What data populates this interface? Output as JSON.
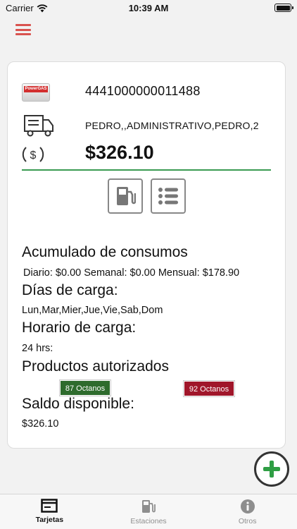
{
  "status_bar": {
    "carrier": "Carrier",
    "time": "10:39 AM"
  },
  "card": {
    "number": "4441000000011488",
    "owner": "PEDRO,,ADMINISTRATIVO,PEDRO,2",
    "balance": "$326.10",
    "logo_text": "PowerGAS",
    "accent_color": "#3a9b52"
  },
  "sections": {
    "consumption_title": "Acumulado de consumos",
    "consumption_text": "Diario: $0.00 Semanal: $0.00 Mensual: $178.90",
    "days_title": "Días de carga:",
    "days_text": "Lun,Mar,Mier,Jue,Vie,Sab,Dom",
    "hours_title": "Horario de carga:",
    "hours_text": "24 hrs:",
    "products_title": "Productos autorizados",
    "products": [
      {
        "label": "87 Octanos",
        "color": "#2e6b2d"
      },
      {
        "label": "92 Octanos",
        "color": "#a0162a"
      }
    ],
    "available_title": "Saldo disponible:",
    "available_text": "$326.10"
  },
  "tabs": [
    {
      "label": "Tarjetas",
      "icon": "card-icon",
      "active": true
    },
    {
      "label": "Estaciones",
      "icon": "gas-pump-icon",
      "active": false
    },
    {
      "label": "Otros",
      "icon": "info-icon",
      "active": false
    }
  ],
  "colors": {
    "menu": "#d9534f",
    "background": "#f2f2f2"
  }
}
